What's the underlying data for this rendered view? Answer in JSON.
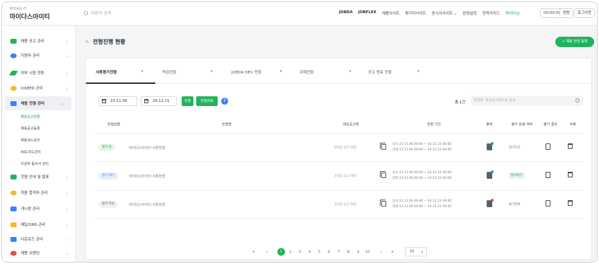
{
  "header": {
    "logo_small": "MIDAS IT",
    "logo": "마이다스아이티",
    "search_placeholder": "지원자 검색",
    "nav": [
      "JOBDA",
      "JOBFLEX",
      "채용사이트",
      "평가자사이트",
      "응시자사이트 ⌄",
      "환경설정",
      "전략가이드",
      "마이다님"
    ],
    "timer": "00:00:00",
    "extend": "연장",
    "logout": "로그아웃"
  },
  "sidebar": {
    "items": [
      {
        "label": "채용 공고 관리",
        "color": "#22b35c"
      },
      {
        "label": "지원자 관리",
        "color": "#3b82f6"
      },
      {
        "label": "외부 시험 연동",
        "color": "#22b35c"
      },
      {
        "label": "InSEED 관리",
        "color": "#f5b82e"
      },
      {
        "label": "채용 전형 관리",
        "color": "#3b82f6"
      },
      {
        "label": "전형 안내 및 발표",
        "color": "#22b35c"
      },
      {
        "label": "최종 합격자 관리",
        "color": "#f5b82e"
      },
      {
        "label": "게시판 관리",
        "color": "#3b82f6"
      },
      {
        "label": "메일/SMS 관리",
        "color": "#f5b82e"
      },
      {
        "label": "다운로드 관리",
        "color": "#3b82f6"
      },
      {
        "label": "채용 브랜딩",
        "color": "#e54b4b"
      }
    ],
    "sub": [
      "채용공고현황",
      "채용공고등록",
      "채용코드관리",
      "NSC코드관리",
      "지원자 동의서 관리"
    ]
  },
  "main": {
    "title": "전형진행 현황",
    "register": "+ 채용 전형 등록",
    "tabs": [
      "서류평가전형",
      "역검전형",
      "JOBDA DEV 전형",
      "과제전형",
      "공고 종료 전형"
    ],
    "start_date": "23.11.06",
    "end_date": "24.12.21",
    "progress_btn": "진행",
    "complete_btn": "진행완료",
    "total": "총 1건",
    "search_placeholder": "전형명, 대상공고명으로 검색",
    "columns": [
      "진행상황",
      "전형명",
      "대상공고명",
      "전형 기간",
      "출력",
      "평가 완료 여부",
      "평가 결과",
      "삭제"
    ],
    "rows": [
      {
        "status": "평가 중",
        "status_bg": "#e3f6e9",
        "status_fg": "#12a548",
        "name": "마이다스아이티 서류전형",
        "target": "응대상 공고 명칭",
        "p1": "응시 23.11.06 00:00 ~ 24.12.21 00:00",
        "p2": "안내 23.11.06 00:00 ~ 24.12.21 00:00",
        "dot": "#22b35c",
        "eval": "평가하기",
        "eval_green": false
      },
      {
        "status": "평가 대기",
        "status_bg": "#e4effe",
        "status_fg": "#3b82f6",
        "name": "마이다스아이티 서류전형",
        "target": "응대상 공고 명칭",
        "p1": "응시 23.11.06 00:00 ~ 24.12.21 00:00",
        "p2": "안내 23.11.06 00:00 ~ 24.12.21 00:00",
        "dot": "#3b82f6",
        "eval": "평가대기",
        "eval_green": true
      },
      {
        "status": "평가 마감",
        "status_bg": "#eef0f2",
        "status_fg": "#555",
        "name": "마이다스아이티 서류전형",
        "target": "응대상 공고 명칭",
        "p1": "응시 23.11.06 00:00 ~ 24.12.21 00:00",
        "p2": "안내 23.11.06 00:00 ~ 24.12.21 00:00",
        "dot": "#e54b4b",
        "eval": "평가완료",
        "eval_green": false
      }
    ],
    "pager": {
      "pages": [
        "1",
        "2",
        "3",
        "4",
        "5",
        "6",
        "7",
        "8",
        "9",
        "10"
      ],
      "first": "«",
      "prev": "‹",
      "next": "›",
      "last": "»",
      "size": "10"
    }
  }
}
